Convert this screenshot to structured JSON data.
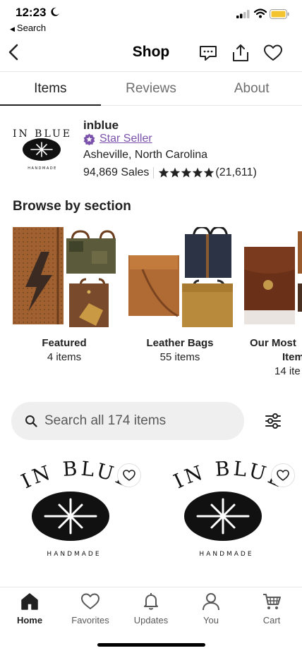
{
  "status_bar": {
    "time": "12:23",
    "back_app_label": "Search"
  },
  "header": {
    "title": "Shop",
    "icons": [
      "back-chevron-icon",
      "message-icon",
      "share-icon",
      "heart-icon"
    ]
  },
  "tabs": [
    {
      "label": "Items",
      "active": true
    },
    {
      "label": "Reviews",
      "active": false
    },
    {
      "label": "About",
      "active": false
    }
  ],
  "shop": {
    "logo_text": "IN BLUE",
    "logo_subtext": "HANDMADE",
    "name": "inblue",
    "badge": "Star Seller",
    "location": "Asheville, North Carolina",
    "sales": "94,869 Sales",
    "rating_stars": 5,
    "review_count": "(21,611)"
  },
  "browse": {
    "title": "Browse by section",
    "sections": [
      {
        "name": "Featured",
        "count": "4 items"
      },
      {
        "name": "Leather Bags",
        "count": "55 items"
      },
      {
        "name": "Our Most",
        "name_line2": "Item",
        "count": "14 ite"
      }
    ]
  },
  "search": {
    "placeholder": "Search all 174 items"
  },
  "listings": [
    {
      "logo_text": "IN BLUE",
      "logo_subtext": "HANDMADE"
    },
    {
      "logo_text": "IN BLUE",
      "logo_subtext": "HANDMADE"
    }
  ],
  "bottom_nav": [
    {
      "label": "Home",
      "icon": "home-icon",
      "active": true
    },
    {
      "label": "Favorites",
      "icon": "heart-icon",
      "active": false
    },
    {
      "label": "Updates",
      "icon": "bell-icon",
      "active": false
    },
    {
      "label": "You",
      "icon": "user-icon",
      "active": false
    },
    {
      "label": "Cart",
      "icon": "cart-icon",
      "active": false
    }
  ],
  "colors": {
    "accent_purple": "#7b52ab",
    "battery_yellow": "#f4c430",
    "text_primary": "#222222",
    "text_secondary": "#595959"
  }
}
